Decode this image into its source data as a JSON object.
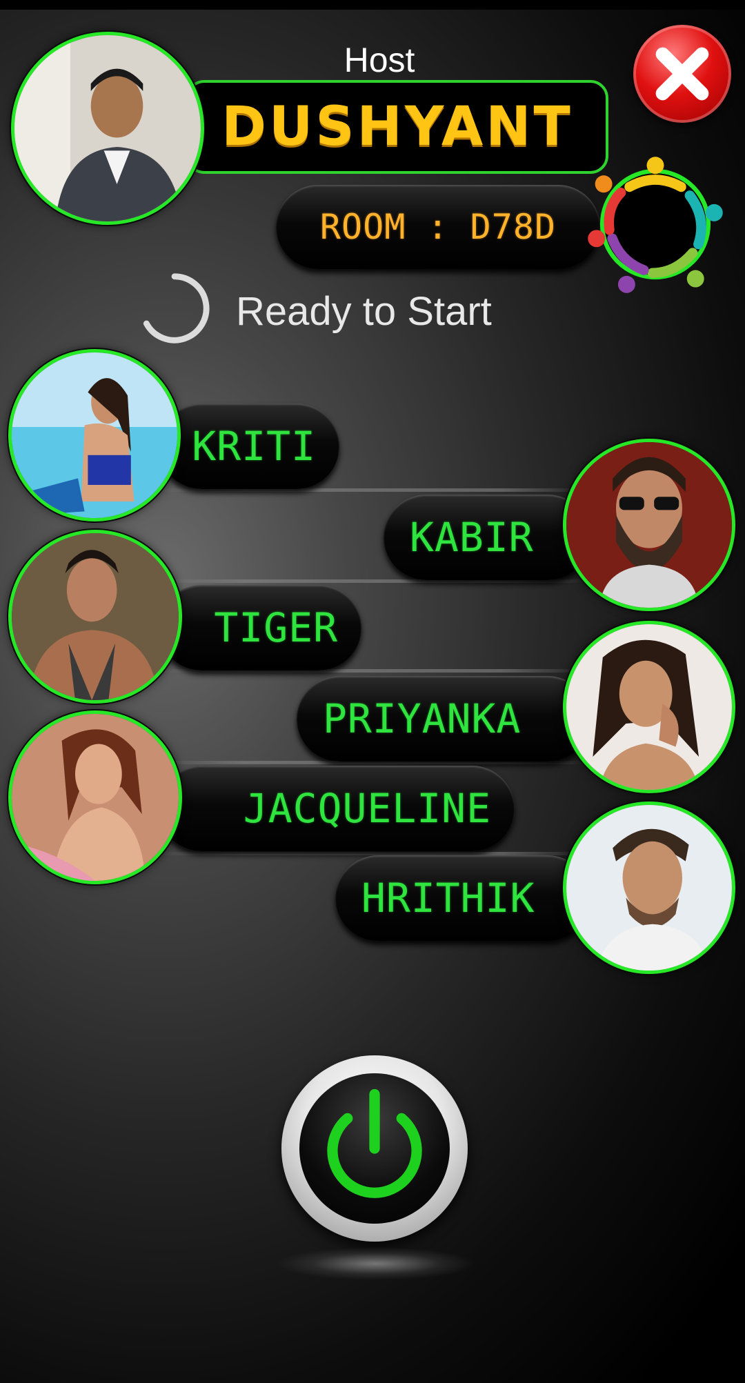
{
  "header": {
    "host_label": "Host",
    "host_name": "DUSHYANT",
    "room_label": "ROOM : D78D"
  },
  "status": {
    "text": "Ready to Start"
  },
  "players": [
    {
      "name": "KRITI",
      "side": "left"
    },
    {
      "name": "KABIR",
      "side": "right"
    },
    {
      "name": "TIGER",
      "side": "left"
    },
    {
      "name": "PRIYANKA",
      "side": "right"
    },
    {
      "name": "JACQUELINE",
      "side": "left"
    },
    {
      "name": "HRITHIK",
      "side": "right"
    }
  ],
  "colors": {
    "accent_green": "#27e827",
    "host_name_yellow": "#ffc414",
    "room_orange": "#ffb22a",
    "close_red": "#e01010"
  },
  "icons": [
    "close-icon",
    "group-icon",
    "loading-spinner-icon",
    "power-icon"
  ]
}
